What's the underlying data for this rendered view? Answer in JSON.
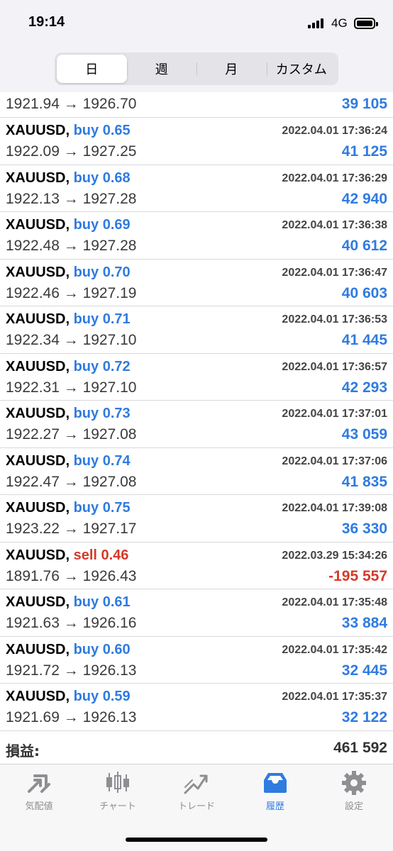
{
  "status_bar": {
    "time": "19:14",
    "network": "4G"
  },
  "period_tabs": [
    {
      "label": "日",
      "active": true
    },
    {
      "label": "週",
      "active": false
    },
    {
      "label": "月",
      "active": false
    },
    {
      "label": "カスタム",
      "active": false
    }
  ],
  "partial_row": {
    "prices": "1921.94 → 1926.70",
    "profit": "39 105"
  },
  "trades": [
    {
      "symbol": "XAUUSD",
      "side": "buy 0.65",
      "type": "buy",
      "datetime": "2022.04.01 17:36:24",
      "prices": "1922.09 → 1927.25",
      "profit": "41 125"
    },
    {
      "symbol": "XAUUSD",
      "side": "buy 0.68",
      "type": "buy",
      "datetime": "2022.04.01 17:36:29",
      "prices": "1922.13 → 1927.28",
      "profit": "42 940"
    },
    {
      "symbol": "XAUUSD",
      "side": "buy 0.69",
      "type": "buy",
      "datetime": "2022.04.01 17:36:38",
      "prices": "1922.48 → 1927.28",
      "profit": "40 612"
    },
    {
      "symbol": "XAUUSD",
      "side": "buy 0.70",
      "type": "buy",
      "datetime": "2022.04.01 17:36:47",
      "prices": "1922.46 → 1927.19",
      "profit": "40 603"
    },
    {
      "symbol": "XAUUSD",
      "side": "buy 0.71",
      "type": "buy",
      "datetime": "2022.04.01 17:36:53",
      "prices": "1922.34 → 1927.10",
      "profit": "41 445"
    },
    {
      "symbol": "XAUUSD",
      "side": "buy 0.72",
      "type": "buy",
      "datetime": "2022.04.01 17:36:57",
      "prices": "1922.31 → 1927.10",
      "profit": "42 293"
    },
    {
      "symbol": "XAUUSD",
      "side": "buy 0.73",
      "type": "buy",
      "datetime": "2022.04.01 17:37:01",
      "prices": "1922.27 → 1927.08",
      "profit": "43 059"
    },
    {
      "symbol": "XAUUSD",
      "side": "buy 0.74",
      "type": "buy",
      "datetime": "2022.04.01 17:37:06",
      "prices": "1922.47 → 1927.08",
      "profit": "41 835"
    },
    {
      "symbol": "XAUUSD",
      "side": "buy 0.75",
      "type": "buy",
      "datetime": "2022.04.01 17:39:08",
      "prices": "1923.22 → 1927.17",
      "profit": "36 330"
    },
    {
      "symbol": "XAUUSD",
      "side": "sell 0.46",
      "type": "sell",
      "datetime": "2022.03.29 15:34:26",
      "prices": "1891.76 → 1926.43",
      "profit": "-195 557"
    },
    {
      "symbol": "XAUUSD",
      "side": "buy 0.61",
      "type": "buy",
      "datetime": "2022.04.01 17:35:48",
      "prices": "1921.63 → 1926.16",
      "profit": "33 884"
    },
    {
      "symbol": "XAUUSD",
      "side": "buy 0.60",
      "type": "buy",
      "datetime": "2022.04.01 17:35:42",
      "prices": "1921.72 → 1926.13",
      "profit": "32 445"
    },
    {
      "symbol": "XAUUSD",
      "side": "buy 0.59",
      "type": "buy",
      "datetime": "2022.04.01 17:35:37",
      "prices": "1921.69 → 1926.13",
      "profit": "32 122"
    }
  ],
  "summary": {
    "label": "損益:",
    "value": "461 592"
  },
  "tab_bar": [
    {
      "label": "気配値",
      "icon": "quotes-icon",
      "active": false
    },
    {
      "label": "チャート",
      "icon": "chart-icon",
      "active": false
    },
    {
      "label": "トレード",
      "icon": "trade-icon",
      "active": false
    },
    {
      "label": "履歴",
      "icon": "history-icon",
      "active": true
    },
    {
      "label": "設定",
      "icon": "settings-icon",
      "active": false
    }
  ],
  "colors": {
    "buy": "#2f7be0",
    "sell": "#d53a2a",
    "active_tab": "#2f7be0",
    "inactive_tab": "#8e8e93"
  }
}
